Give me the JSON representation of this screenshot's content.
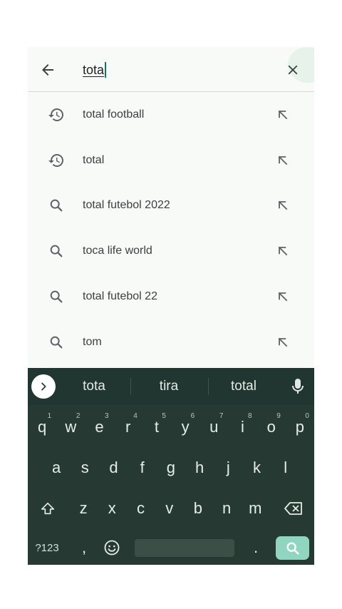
{
  "search": {
    "query": "tota",
    "back_icon": "arrow-left-icon",
    "clear_icon": "close-icon"
  },
  "suggestions": [
    {
      "label": "total football",
      "icon": "history-icon"
    },
    {
      "label": "total",
      "icon": "history-icon"
    },
    {
      "label": "total futebol 2022",
      "icon": "search-icon"
    },
    {
      "label": "toca life world",
      "icon": "search-icon"
    },
    {
      "label": "total futebol 22",
      "icon": "search-icon"
    },
    {
      "label": "tom",
      "icon": "search-icon"
    }
  ],
  "keyboard": {
    "suggestions": [
      "tota",
      "tira",
      "total"
    ],
    "row1": [
      {
        "key": "q",
        "hint": "1"
      },
      {
        "key": "w",
        "hint": "2"
      },
      {
        "key": "e",
        "hint": "3"
      },
      {
        "key": "r",
        "hint": "4"
      },
      {
        "key": "t",
        "hint": "5"
      },
      {
        "key": "y",
        "hint": "6"
      },
      {
        "key": "u",
        "hint": "7"
      },
      {
        "key": "i",
        "hint": "8"
      },
      {
        "key": "o",
        "hint": "9"
      },
      {
        "key": "p",
        "hint": "0"
      }
    ],
    "row2": [
      "a",
      "s",
      "d",
      "f",
      "g",
      "h",
      "j",
      "k",
      "l"
    ],
    "row3": [
      "z",
      "x",
      "c",
      "v",
      "b",
      "n",
      "m"
    ],
    "symbols_label": "?123",
    "comma_label": ",",
    "period_label": "."
  },
  "colors": {
    "accent": "#0b7a5c",
    "keyboard_bg": "#263a33",
    "search_key": "#8fd5c0"
  }
}
